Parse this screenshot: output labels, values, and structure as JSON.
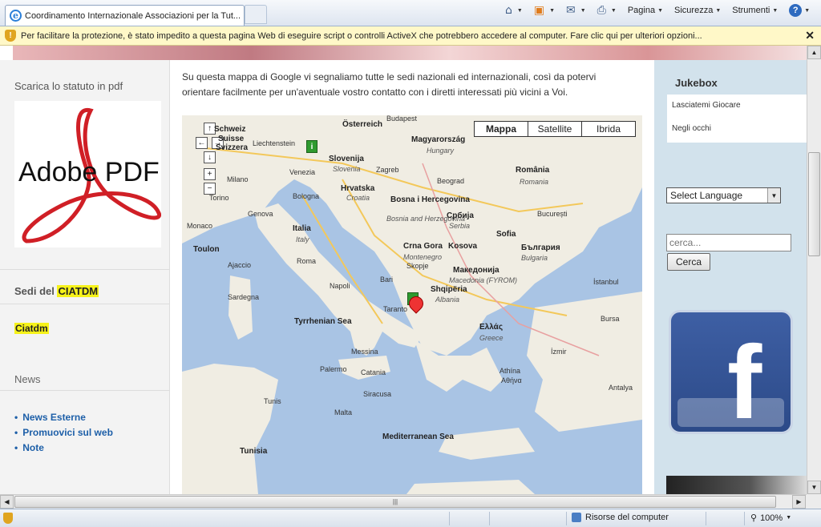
{
  "browser": {
    "tab_title": "Coordinamento Internazionale Associazioni per la Tut...",
    "commands": {
      "home": "home-icon",
      "pagina": "Pagina",
      "sicurezza": "Sicurezza",
      "strumenti": "Strumenti"
    },
    "info_bar": "Per facilitare la protezione, è stato impedito a questa pagina Web di eseguire script o controlli ActiveX che potrebbero accedere al computer. Fare clic qui per ulteriori opzioni...",
    "status": {
      "zone": "Risorse del computer",
      "zoom": "100%"
    }
  },
  "left": {
    "pdf_title": "Scarica lo statuto in pdf",
    "pdf_logo": "Adobe PDF",
    "sedi_prefix": "Sedi del",
    "sedi_highlight": "CIATDM",
    "ciatdm_link": "Ciatdm",
    "news_title": "News",
    "news_items": [
      "News Esterne",
      "Promuovici sul web",
      "Note"
    ]
  },
  "main": {
    "intro": "Su questa mappa di Google vi segnaliamo tutte le sedi nazionali ed internazionali, così da potervi orientare facilmente per un'aventuale vostro contatto con i diretti interessati più vicini a Voi.",
    "map_types": [
      "Mappa",
      "Satellite",
      "Ibrida"
    ],
    "selected_map_type": "Mappa",
    "map_labels": [
      "Österreich",
      "Budapest",
      "Magyarország",
      "Hungary",
      "Schweiz",
      "Suisse",
      "Svizzera",
      "Liechtenstein",
      "Slovenija",
      "Slovenia",
      "Zagreb",
      "Hrvatska",
      "Croatia",
      "Bosna i Hercegovina",
      "Bosnia and Herzegovina",
      "Beograd",
      "Србија",
      "Serbia",
      "Crna Gora",
      "Montenegro",
      "Kosova",
      "Skopje",
      "Македонија",
      "Macedonia (FYROM)",
      "Shqipëria",
      "Albania",
      "România",
      "Romania",
      "București",
      "Sofia",
      "България",
      "Bulgaria",
      "Ελλάς",
      "Greece",
      "Athína",
      "Αθήνα",
      "İzmir",
      "İstanbul",
      "Bursa",
      "Antalya",
      "Milano",
      "Venezia",
      "Torino",
      "Genova",
      "Bologna",
      "Italia",
      "Italy",
      "Roma",
      "Napoli",
      "Bari",
      "Taranto",
      "Palermo",
      "Catania",
      "Messina",
      "Tyrrhenian Sea",
      "Mediterranean Sea",
      "Sardegna",
      "Tunisia",
      "Tunis",
      "Malta",
      "Siracusa",
      "Monaco",
      "Toulon",
      "Ajaccio"
    ]
  },
  "right": {
    "jukebox_title": "Jukebox",
    "jukebox_items": [
      "Lasciatemi Giocare",
      "Negli occhi"
    ],
    "language_select": "Select Language",
    "search_placeholder": "cerca...",
    "search_button": "Cerca",
    "social_icon": "facebook-icon"
  }
}
